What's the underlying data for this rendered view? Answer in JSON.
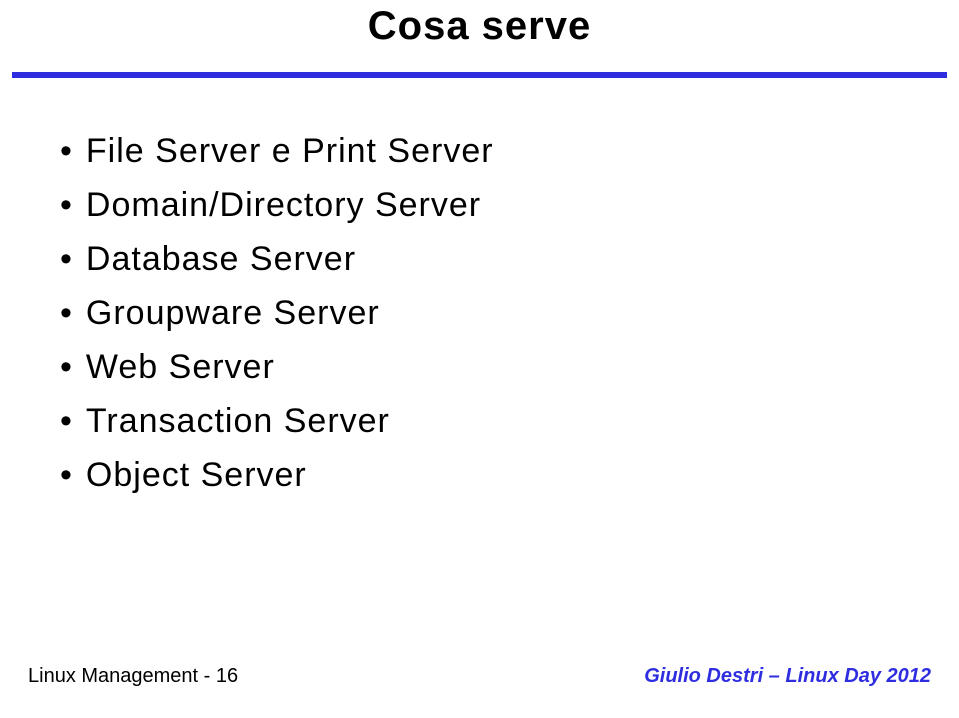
{
  "title": "Cosa serve",
  "bullets": [
    "File Server e Print Server",
    "Domain/Directory Server",
    "Database Server",
    "Groupware Server",
    "Web Server",
    "Transaction Server",
    "Object Server"
  ],
  "footer": {
    "left": "Linux Management - 16",
    "right": "Giulio Destri – Linux Day 2012"
  }
}
